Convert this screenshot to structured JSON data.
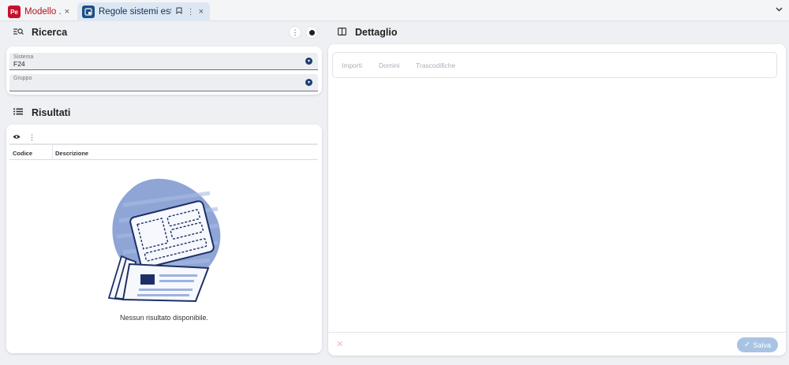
{
  "tabs": [
    {
      "logo": "Pe",
      "label": "Modello ...",
      "close": "×"
    },
    {
      "logo": "",
      "label": "Regole sistemi esterni",
      "close": "×"
    }
  ],
  "icons": {
    "bookmark": "bookmark-icon",
    "more": "more-vert-icon",
    "collapse": "chevron-down-icon",
    "search_list": "search-list-icon",
    "list": "list-icon",
    "panel": "panel-icon",
    "eye": "eye-icon",
    "dropdown": "dropdown-circle-icon",
    "check": "check-icon"
  },
  "ricerca": {
    "title": "Ricerca",
    "fields": [
      {
        "label": "Sistema",
        "value": "F24"
      },
      {
        "label": "Gruppo",
        "value": ""
      }
    ]
  },
  "risultati": {
    "title": "Risultati",
    "columns": [
      "Codice",
      "Descrizione"
    ],
    "empty_message": "Nessun risultato disponibile."
  },
  "dettaglio": {
    "title": "Dettaglio",
    "tabs": [
      "Importi",
      "Domini",
      "Trascodifiche"
    ],
    "cancel_symbol": "✕",
    "save_label": "Salva"
  },
  "colors": {
    "brand_red": "#c8102e",
    "brand_blue": "#1d4f86",
    "accent_navy": "#1f3f70",
    "illustration_blob": "#8fa5d6",
    "save_disabled": "#a9c3e3"
  }
}
